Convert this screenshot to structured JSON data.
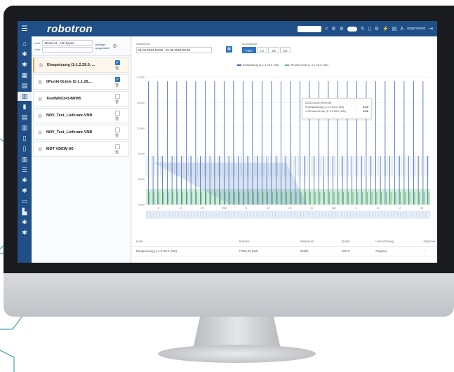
{
  "app": {
    "logo": "robotron",
    "user_label": "angemeldet"
  },
  "colors": {
    "brand": "#1f4f86",
    "accent": "#2f74c0",
    "series1": "#2f5fb0",
    "series2": "#5cc36a",
    "selection": "#f2a33a"
  },
  "nav": {
    "icons": [
      "home-icon",
      "plugin-icon",
      "plugin-icon",
      "grid-icon",
      "table-icon",
      "chart-icon",
      "bar-chart-icon",
      "table-icon",
      "chart-icon",
      "document-icon",
      "document-icon",
      "chart-icon",
      "list-icon",
      "plugin-icon",
      "plugin-icon",
      "monitor-icon",
      "factory-icon",
      "plugin-icon",
      "plugin-icon"
    ]
  },
  "list_panel": {
    "label_1": "Linie",
    "select_value": "Messl ist - Alle Typen",
    "label_2": "Linie",
    "right_label": "Anfänge ausgewählt",
    "items": [
      {
        "label": "Einspeisung (1-1.2.29.0, ...",
        "checked": true,
        "selected": true
      },
      {
        "label": "0Punkt-0Linie (1-1.1.29,...",
        "checked": true,
        "selected": false
      },
      {
        "label": "TestWRD3414WW5",
        "checked": false,
        "selected": false
      },
      {
        "label": "NNV_Test_Lieferant-VNB",
        "checked": false,
        "selected": false
      },
      {
        "label": "NNV_Test_Lieferant-VNB",
        "checked": false,
        "selected": false
      },
      {
        "label": "MDT VDEW-H0",
        "checked": false,
        "selected": false
      }
    ]
  },
  "filters": {
    "range_label": "Zeitbereich",
    "range_value": "01.02.2023 00:00 - 31.05.2023 00:00",
    "granularity_label": "Granularität",
    "granularity": [
      "Flexi",
      "Tü",
      "Tal",
      "Nu"
    ]
  },
  "chart_data": {
    "type": "bar",
    "series": [
      {
        "name": "Einspeisung (1-1.2.29.0, kW)",
        "color": "#2f5fb0"
      },
      {
        "name": "0Punkt-0Linie (1-1.1.29.0, kW)",
        "color": "#5cc36a"
      }
    ],
    "ylabels": [
      "17 kW",
      "14 kW",
      "11 kW",
      "8 kW",
      "5 kW",
      "0 kW"
    ],
    "xlabels": [
      "6",
      "13",
      "20",
      "Mar",
      "6",
      "13",
      "20",
      "27",
      "Apr",
      "3",
      "10",
      "17",
      "24"
    ],
    "tooltip": {
      "title": "2023-03-28 09:00:00",
      "rows": [
        {
          "name": "Einspeisung (1-1.2.29.0, kW)",
          "value": "8.00"
        },
        {
          "name": "0Punkt-0Linie (1-1.1.29.0, kW)",
          "value": "3.52"
        }
      ]
    }
  },
  "table": {
    "headers": [
      "Linie",
      "Summe",
      "Maximum",
      "Quote",
      "Umrechnung",
      "Optionen"
    ],
    "rows": [
      [
        "Einspeisung (1-1.2.29.0, kW)",
        "7.825,20 kWh",
        "6kWh",
        "100 %",
        "Original",
        "⋮"
      ]
    ]
  }
}
